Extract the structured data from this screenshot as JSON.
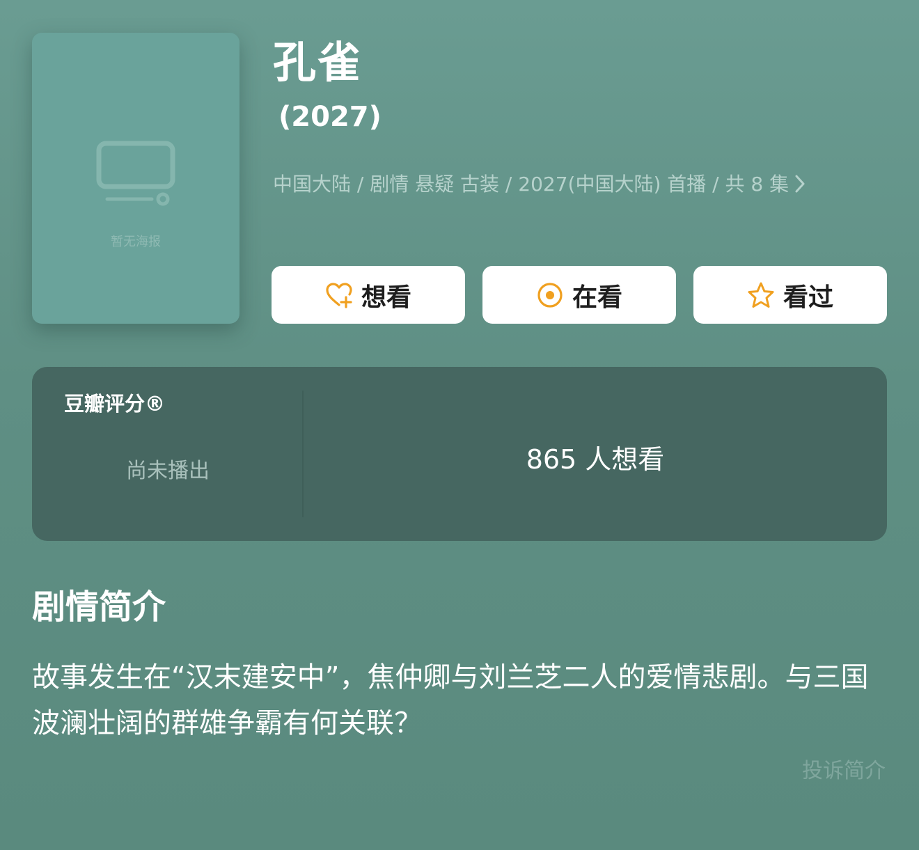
{
  "poster": {
    "placeholder_text": "暂无海报",
    "icon": "tv-icon"
  },
  "title": "孔雀",
  "year": "(2027)",
  "meta": {
    "text": "中国大陆 / 剧情 悬疑 古装 / 2027(中国大陆) 首播 / 共 8 集",
    "icon": "chevron-right-icon"
  },
  "actions": {
    "want_label": "想看",
    "want_icon": "heart-plus-icon",
    "watching_label": "在看",
    "watching_icon": "target-circle-icon",
    "watched_label": "看过",
    "watched_icon": "star-outline-icon",
    "accent_color": "#f0a020"
  },
  "rating": {
    "label": "豆瓣评分®",
    "status": "尚未播出",
    "want_count_text": "865 人想看"
  },
  "synopsis": {
    "title": "剧情简介",
    "text": "故事发生在“汉末建安中”，焦仲卿与刘兰芝二人的爱情悲剧。与三国波澜壮阔的群雄争霸有何关联？",
    "report_label": "投诉简介"
  },
  "colors": {
    "background": "#5f8f84",
    "card": "#466761",
    "button_bg": "#ffffff"
  }
}
